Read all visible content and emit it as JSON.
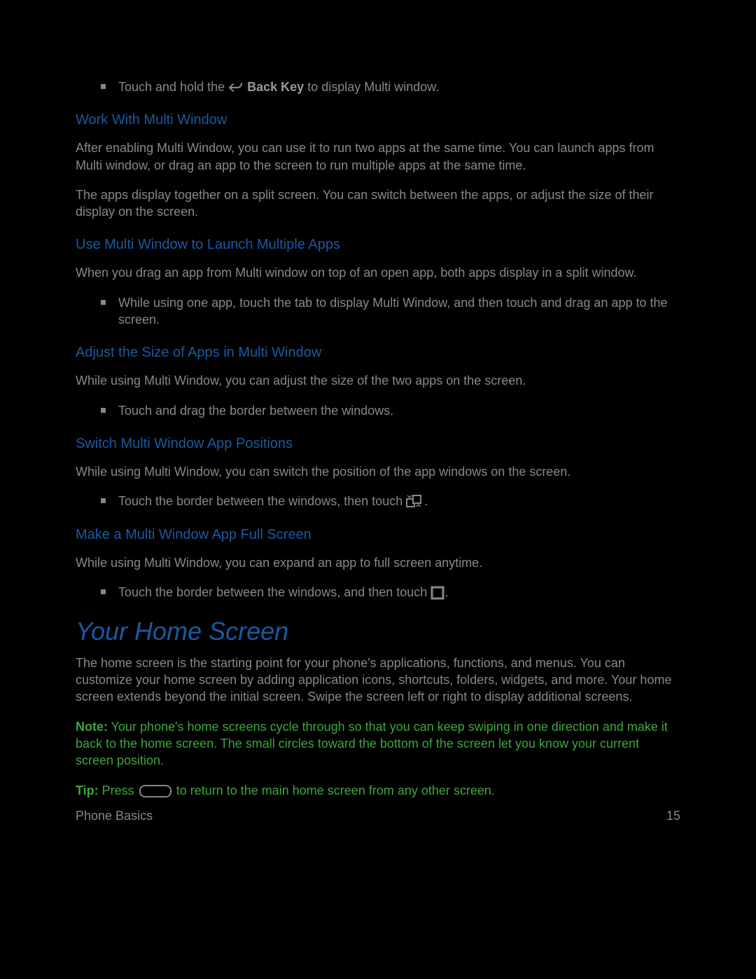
{
  "top_bullet": {
    "pre": "Touch and hold the ",
    "key": "Back Key",
    "post": " to display Multi window."
  },
  "sections": [
    {
      "heading": "Work With Multi Window",
      "paras": [
        "After enabling Multi Window, you can use it to run two apps at the same time. You can launch apps from Multi window, or drag an app to the screen to run multiple apps at the same time.",
        "The apps display together on a split screen. You can switch between the apps, or adjust the size of their display on the screen."
      ]
    },
    {
      "heading": "Use Multi Window to Launch Multiple Apps",
      "paras": [
        "When you drag an app from Multi window on top of an open app, both apps display in a split window."
      ],
      "bullet": "While using one app, touch the tab to display Multi Window, and then touch and drag an app to the screen."
    },
    {
      "heading": "Adjust the Size of Apps in Multi Window",
      "paras": [
        "While using Multi Window, you can adjust the size of the two apps on the screen."
      ],
      "bullet": "Touch and drag the border between the windows."
    },
    {
      "heading": "Switch Multi Window App Positions",
      "paras": [
        "While using Multi Window, you can switch the position of the app windows on the screen."
      ],
      "bullet": "Touch the border between the windows, then touch ",
      "bullet_end": "."
    },
    {
      "heading": "Make a Multi Window App Full Screen",
      "paras": [
        "While using Multi Window, you can expand an app to full screen anytime."
      ],
      "bullet": "Touch the border between the windows, and then touch ",
      "bullet_end": "."
    }
  ],
  "home": {
    "heading": "Your Home Screen",
    "para": "The home screen is the starting point for your phone's applications, functions, and menus. You can customize your home screen by adding application icons, shortcuts, folders, widgets, and more. Your home screen extends beyond the initial screen. Swipe the screen left or right to display additional screens.",
    "note_label": "Note:",
    "note_text": " Your phone's home screens cycle through so that you can keep swiping in one direction and make it back to the home screen. The small circles toward the bottom of the screen let you know your current screen position.",
    "tip_label": "Tip:",
    "tip_pre": " Press ",
    "tip_post": " to return to the main home screen from any other screen."
  },
  "footer": {
    "left": "Phone Basics",
    "right": "15"
  }
}
